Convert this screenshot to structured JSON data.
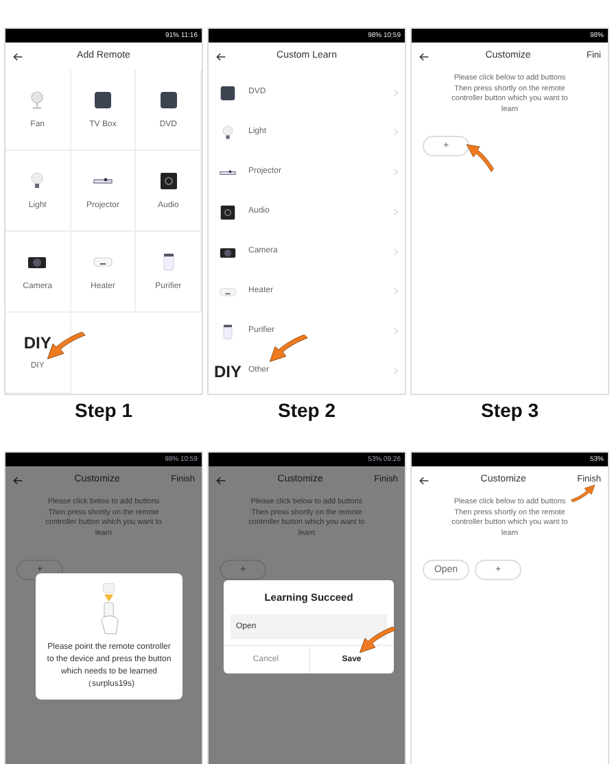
{
  "top_row": [
    {
      "step": "Step 1",
      "screen": {
        "kind": "grid",
        "status": "91% 11:16",
        "title": "Add Remote",
        "items": [
          {
            "label": "Fan",
            "kind": "fan",
            "pointed": false
          },
          {
            "label": "TV Box",
            "kind": "box",
            "pointed": false
          },
          {
            "label": "DVD",
            "kind": "box",
            "pointed": false
          },
          {
            "label": "Light",
            "kind": "light",
            "pointed": false
          },
          {
            "label": "Projector",
            "kind": "projector",
            "pointed": false
          },
          {
            "label": "Audio",
            "kind": "audio",
            "pointed": false
          },
          {
            "label": "Camera",
            "kind": "camera",
            "pointed": false
          },
          {
            "label": "Heater",
            "kind": "heater",
            "pointed": false
          },
          {
            "label": "Purifier",
            "kind": "purifier",
            "pointed": false
          },
          {
            "label": "DIY",
            "kind": "text",
            "icon_text": "DIY",
            "pointed": true
          }
        ]
      }
    },
    {
      "step": "Step 2",
      "screen": {
        "kind": "list",
        "status": "98% 10:59",
        "title": "Custom Learn",
        "items": [
          {
            "label": "DVD",
            "kind": "box",
            "pointed": false
          },
          {
            "label": "Light",
            "kind": "light",
            "pointed": false
          },
          {
            "label": "Projector",
            "kind": "projector",
            "pointed": false
          },
          {
            "label": "Audio",
            "kind": "audio",
            "pointed": false
          },
          {
            "label": "Camera",
            "kind": "camera",
            "pointed": false
          },
          {
            "label": "Heater",
            "kind": "heater",
            "pointed": false
          },
          {
            "label": "Purifier",
            "kind": "purifier",
            "pointed": false
          },
          {
            "label": "Other",
            "kind": "text",
            "icon_text": "DIY",
            "pointed": true
          }
        ]
      }
    },
    {
      "step": "Step 3",
      "screen": {
        "kind": "customize",
        "status": "98%",
        "title": "Customize",
        "action": "Fini",
        "action_pointed": false,
        "instructions": "Please click below to add buttons Then press shortly on the remote controller button which you want to learn",
        "buttons": [
          {
            "label": "+",
            "pointed": true
          }
        ]
      }
    }
  ],
  "bottom_row": [
    {
      "screen": {
        "kind": "customize",
        "status": "98% 10:59",
        "title": "Customize",
        "action": "Finish",
        "action_pointed": false,
        "instructions": "Please click below to add buttons Then press shortly on the remote controller button which you want to learn",
        "buttons": [
          {
            "label": "+",
            "pointed": false
          }
        ],
        "dialog": {
          "kind": "pointing",
          "text": "Please point the remote controller to the device and press the button which needs to be learned（surplus19s)"
        }
      }
    },
    {
      "screen": {
        "kind": "customize",
        "status": "53% 09:26",
        "title": "Customize",
        "action": "Finish",
        "action_pointed": false,
        "instructions": "Please click below to add buttons Then press shortly on the remote controller button which you want to learn",
        "buttons": [
          {
            "label": "+",
            "pointed": false
          }
        ],
        "dialog": {
          "kind": "success",
          "title": "Learning Succeed",
          "value": "Open",
          "cancel": "Cancel",
          "confirm": "Save",
          "confirm_pointed": true
        }
      }
    },
    {
      "screen": {
        "kind": "customize",
        "status": "53%",
        "title": "Customize",
        "action": "Finish",
        "action_pointed": true,
        "instructions": "Please click below to add buttons Then press shortly on the remote controller button which you want to learn",
        "buttons": [
          {
            "label": "Open",
            "pointed": false
          },
          {
            "label": "+",
            "pointed": false
          }
        ]
      }
    }
  ]
}
